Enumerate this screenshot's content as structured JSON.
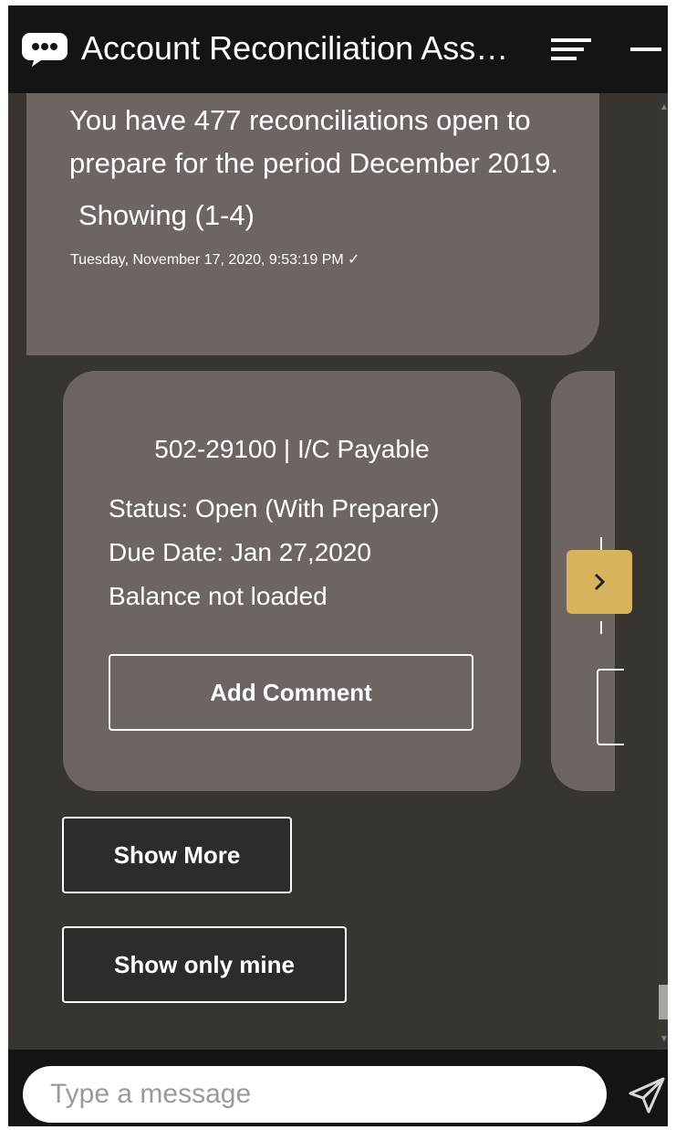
{
  "header": {
    "title": "Account Reconciliation Ass…"
  },
  "message": {
    "text": "You have 477 reconciliations open to prepare for the period December 2019.",
    "showing": "Showing (1-4)",
    "timestamp": "Tuesday, November 17, 2020, 9:53:19 PM ✓"
  },
  "card": {
    "title": "502-29100 | I/C Payable",
    "status": "Status: Open (With Preparer)",
    "due_date": "Due Date: Jan 27,2020",
    "balance": "Balance not loaded",
    "button": "Add Comment"
  },
  "actions": {
    "show_more": "Show More",
    "show_only_mine": "Show only mine"
  },
  "footer": {
    "placeholder": "Type a message"
  },
  "colors": {
    "header_bg": "#141414",
    "body_bg": "#383430",
    "bubble_bg": "#6d6561",
    "accent": "#d8b35e"
  },
  "icons": [
    "chat-bubble-icon",
    "hamburger-menu-icon",
    "minimize-icon",
    "chevron-right-icon",
    "send-icon"
  ]
}
